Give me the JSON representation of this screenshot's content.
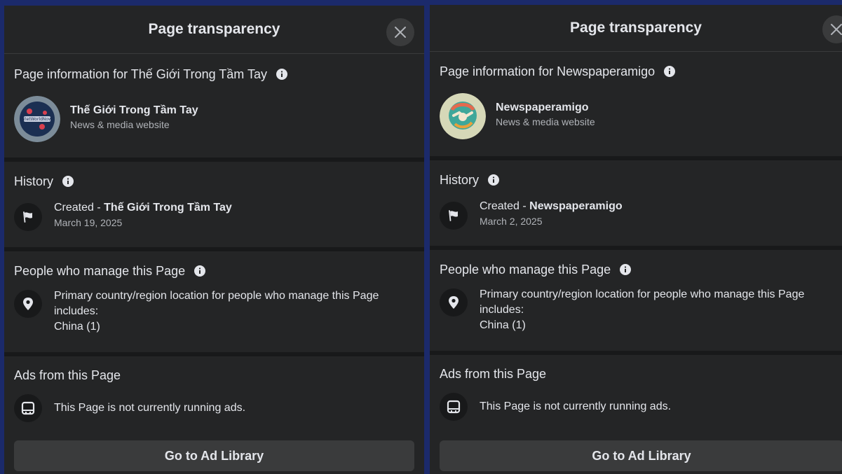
{
  "panels": [
    {
      "header_title": "Page transparency",
      "page_info_title": "Page information for Thế Giới Trong Tầm Tay",
      "page_name": "Thế Giới Trong Tầm Tay",
      "page_category": "News & media website",
      "history_title": "History",
      "created_prefix": "Created - ",
      "created_name": "Thế Giới Trong Tầm Tay",
      "created_date": "March 19, 2025",
      "managers_title": "People who manage this Page",
      "managers_text_1": "Primary country/region location for people who manage this Page",
      "managers_text_2": "includes:",
      "managers_country": "China (1)",
      "ads_title": "Ads from this Page",
      "ads_status": "This Page is not currently running ads.",
      "ad_library_label": "Go to Ad Library",
      "avatar_logo_text": "VietWorldNow"
    },
    {
      "header_title": "Page transparency",
      "page_info_title": "Page information for Newspaperamigo",
      "page_name": "Newspaperamigo",
      "page_category": "News & media website",
      "history_title": "History",
      "created_prefix": "Created - ",
      "created_name": "Newspaperamigo",
      "created_date": "March 2, 2025",
      "managers_title": "People who manage this Page",
      "managers_text_1": "Primary country/region location for people who manage this Page",
      "managers_text_2": "includes:",
      "managers_country": "China (1)",
      "ads_title": "Ads from this Page",
      "ads_status": "This Page is not currently running ads.",
      "ad_library_label": "Go to Ad Library"
    }
  ],
  "icons": {
    "close": "close-icon",
    "info": "info-icon",
    "flag": "flag-icon",
    "location": "location-pin-icon",
    "ads": "ads-board-icon"
  },
  "colors": {
    "panel_bg": "#242526",
    "divider": "#18191a",
    "button_bg": "#3a3b3c",
    "text_primary": "#e4e6eb",
    "text_secondary": "#b0b3b8",
    "frame": "#1b2a6b"
  }
}
